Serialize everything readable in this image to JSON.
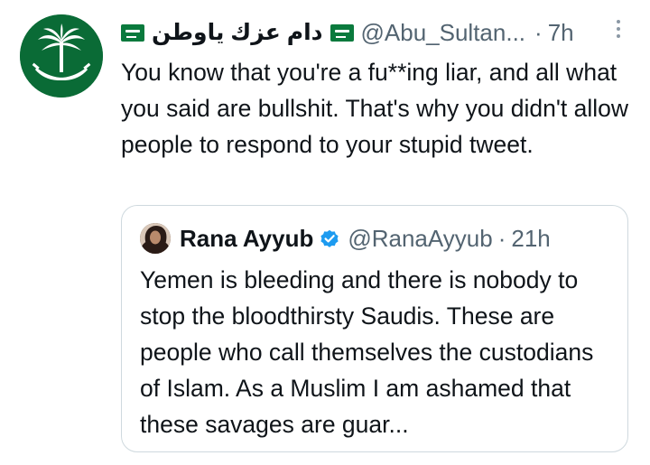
{
  "tweet": {
    "author": {
      "display_name": "دام عزك ياوطن",
      "handle": "@Abu_Sultan...",
      "flag_icon": "saudi-flag-icon",
      "avatar_icon": "saudi-emblem-avatar"
    },
    "separator": "·",
    "time": "7h",
    "more_icon": "more-vertical-icon",
    "text": "You know that you're a fu**ing liar, and all what you said are bullshit. That's why you didn't allow people to respond to your stupid tweet."
  },
  "quoted_tweet": {
    "author": {
      "display_name": "Rana Ayyub",
      "handle": "@RanaAyyub",
      "verified_icon": "verified-badge-icon",
      "avatar_icon": "profile-photo-avatar"
    },
    "separator": "·",
    "time": "21h",
    "text": "Yemen is bleeding and there is nobody to stop the bloodthirsty Saudis. These are people who call themselves the custodians of Islam. As a Muslim I am ashamed that these savages are guar..."
  },
  "colors": {
    "text": "#0f1419",
    "secondary": "#536471",
    "border": "#cfd9de",
    "verified": "#1d9bf0",
    "avatar_green": "#0a6b36"
  }
}
